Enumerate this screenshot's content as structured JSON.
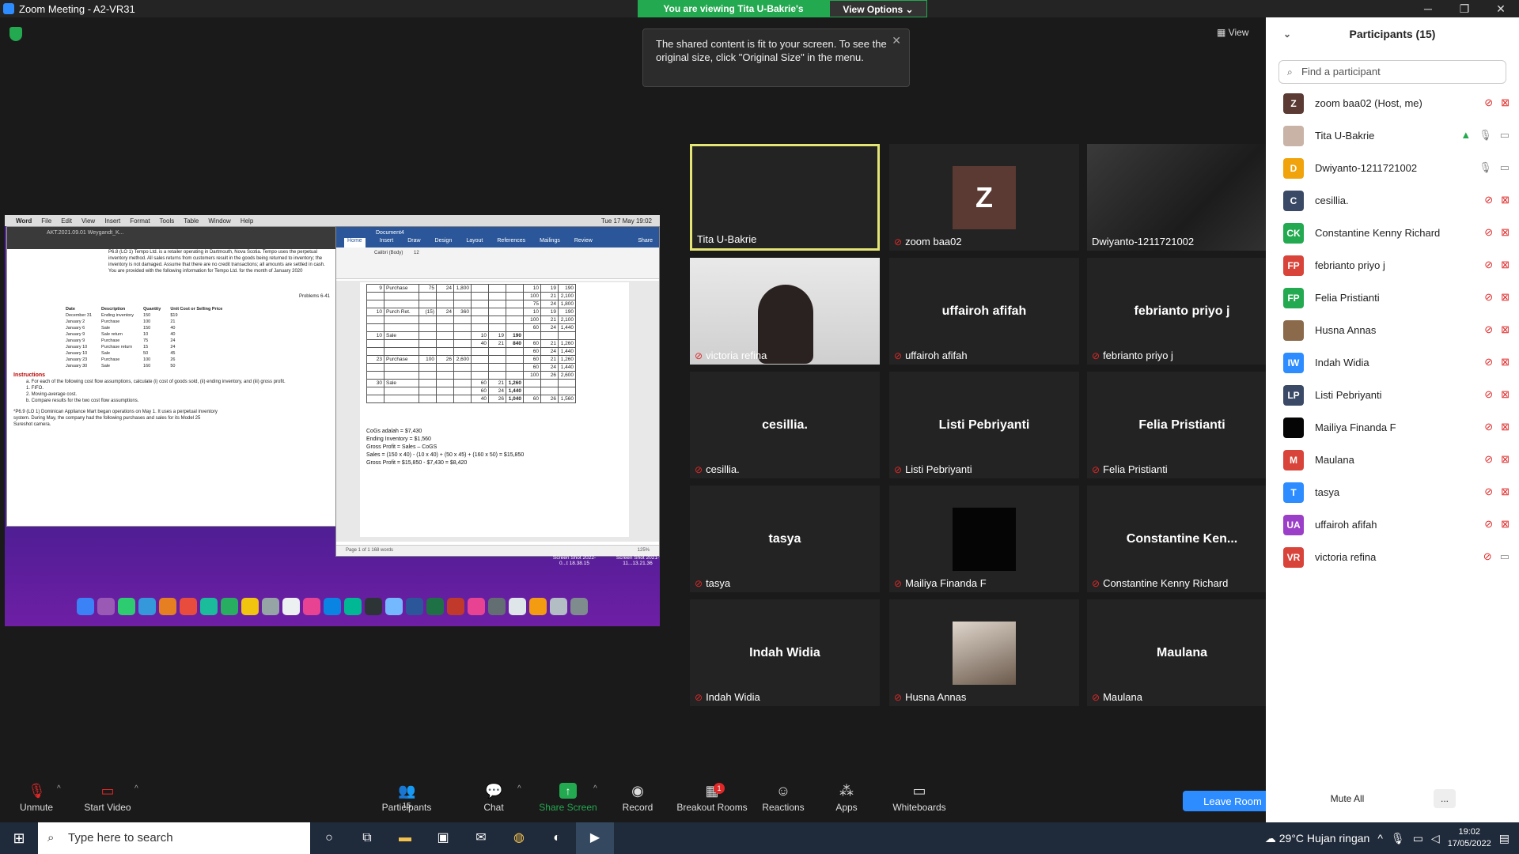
{
  "window": {
    "title": "Zoom Meeting - A2-VR31",
    "minimize": "─",
    "maximize": "❐",
    "close": "✕"
  },
  "banner": {
    "viewing": "You are viewing Tita U-Bakrie's screen",
    "view_options": "View Options ⌄"
  },
  "view_button": "View",
  "toast": {
    "text": "The shared content is fit to your screen. To see the original size, click \"Original Size\" in the menu."
  },
  "shared_screen": {
    "mac_menu": [
      "Word",
      "File",
      "Edit",
      "View",
      "Insert",
      "Format",
      "Tools",
      "Table",
      "Window",
      "Help"
    ],
    "mac_clock": "Tue 17 May 19:02",
    "pdf_title": "AKT.2021.09.01 Weygandt_K...",
    "pdf_problem": "P6.8 (LO 1) Tempo Ltd. is a retailer operating in Dartmouth, Nova Scotia. Tempo uses the perpetual inventory method. All sales returns from customers result in the goods being returned to inventory; the inventory is not damaged. Assume that there are no credit transactions; all amounts are settled in cash. You are provided with the following information for Tempo Ltd. for the month of January 2020",
    "pdf_header": "Problems 6-41",
    "pdf_table_head": [
      "Date",
      "Description",
      "Quantity",
      "Unit Cost or Selling Price"
    ],
    "pdf_table_rows": [
      [
        "December 31",
        "Ending inventory",
        "150",
        "$19"
      ],
      [
        "January 2",
        "Purchase",
        "100",
        "21"
      ],
      [
        "January 6",
        "Sale",
        "150",
        "40"
      ],
      [
        "January 9",
        "Sale return",
        "10",
        "40"
      ],
      [
        "January 9",
        "Purchase",
        "75",
        "24"
      ],
      [
        "January 10",
        "Purchase return",
        "15",
        "24"
      ],
      [
        "January 10",
        "Sale",
        "50",
        "45"
      ],
      [
        "January 23",
        "Purchase",
        "100",
        "26"
      ],
      [
        "January 30",
        "Sale",
        "160",
        "50"
      ]
    ],
    "pdf_instructions_title": "Instructions",
    "pdf_instructions": [
      "a. For each of the following cost flow assumptions, calculate (i) cost of goods sold, (ii) ending inventory, and (iii) gross profit.",
      "1. FIFO.",
      "2. Moving-average cost.",
      "b. Compare results for the two cost flow assumptions."
    ],
    "pdf_next_problem": "*P6.9 (LO 1) Dominican Appliance Mart began operations on May 1. It uses a perpetual inventory system. During May, the company had the following purchases and sales for its Model 25 Sureshot camera.",
    "word_title": "Document4",
    "word_tabs": [
      "Home",
      "Insert",
      "Draw",
      "Design",
      "Layout",
      "References",
      "Mailings",
      "Review"
    ],
    "word_font": "Calibri (Body)",
    "word_size": "12",
    "word_share": "Share",
    "word_table": [
      [
        "9",
        "Purchase",
        "75",
        "24",
        "1,800",
        "",
        "",
        "",
        "10",
        "19",
        "190"
      ],
      [
        "",
        "",
        "",
        "",
        "",
        "",
        "",
        "",
        "100",
        "21",
        "2,100"
      ],
      [
        "",
        "",
        "",
        "",
        "",
        "",
        "",
        "",
        "75",
        "24",
        "1,800"
      ],
      [
        "10",
        "Purch Ret.",
        "(15)",
        "24",
        "360",
        "",
        "",
        "",
        "10",
        "19",
        "190"
      ],
      [
        "",
        "",
        "",
        "",
        "",
        "",
        "",
        "",
        "100",
        "21",
        "2,100"
      ],
      [
        "",
        "",
        "",
        "",
        "",
        "",
        "",
        "",
        "60",
        "24",
        "1,440"
      ],
      [
        "10",
        "Sale",
        "",
        "",
        "",
        "10",
        "19",
        "190",
        "",
        "",
        ""
      ],
      [
        "",
        "",
        "",
        "",
        "",
        "40",
        "21",
        "840",
        "60",
        "21",
        "1,260"
      ],
      [
        "",
        "",
        "",
        "",
        "",
        "",
        "",
        "",
        "60",
        "24",
        "1,440"
      ],
      [
        "23",
        "Purchase",
        "100",
        "26",
        "2,600",
        "",
        "",
        "",
        "60",
        "21",
        "1,260"
      ],
      [
        "",
        "",
        "",
        "",
        "",
        "",
        "",
        "",
        "60",
        "24",
        "1,440"
      ],
      [
        "",
        "",
        "",
        "",
        "",
        "",
        "",
        "",
        "100",
        "26",
        "2,600"
      ],
      [
        "30",
        "Sale",
        "",
        "",
        "",
        "60",
        "21",
        "1,260",
        "",
        "",
        ""
      ],
      [
        "",
        "",
        "",
        "",
        "",
        "60",
        "24",
        "1,440",
        "",
        "",
        ""
      ],
      [
        "",
        "",
        "",
        "",
        "",
        "40",
        "26",
        "1,040",
        "60",
        "26",
        "1,560"
      ]
    ],
    "word_lines": [
      "CoGs adalah = $7,430",
      "Ending Inventory = $1,560",
      "Gross Profit = Sales – CoGS",
      "Sales = (150 x 40) - (10 x 40) + (50 x 45) + (160 x 50) = $15,850",
      "Gross Profit = $15,850 - $7,430 = $8,420"
    ],
    "word_status": "Page 1 of 1    168 words",
    "word_zoom": "125%",
    "screenshot1": "Screen Shot 2022-0...t 18.38.15",
    "screenshot2": "Screen Shot 2021-11...13.21.36"
  },
  "tiles": [
    {
      "name": "Tita U-Bakrie",
      "label": "",
      "muted": false
    },
    {
      "name": "zoom baa02",
      "label": "Z",
      "muted": true
    },
    {
      "name": "Dwiyanto-1211721002",
      "label": "",
      "muted": false
    },
    {
      "name": "victoria refina",
      "label": "",
      "muted": true
    },
    {
      "name": "uffairoh afifah",
      "label": "uffairoh afifah",
      "muted": true
    },
    {
      "name": "febrianto priyo j",
      "label": "febrianto priyo j",
      "muted": true
    },
    {
      "name": "cesillia.",
      "label": "cesillia.",
      "muted": true
    },
    {
      "name": "Listi Pebriyanti",
      "label": "Listi Pebriyanti",
      "muted": true
    },
    {
      "name": "Felia Pristianti",
      "label": "Felia Pristianti",
      "muted": true
    },
    {
      "name": "tasya",
      "label": "tasya",
      "muted": true
    },
    {
      "name": "Mailiya Finanda F",
      "label": "",
      "muted": true
    },
    {
      "name": "Constantine Kenny Richard",
      "label": "Constantine  Ken...",
      "muted": true
    },
    {
      "name": "Indah Widia",
      "label": "Indah Widia",
      "muted": true
    },
    {
      "name": "Husna Annas",
      "label": "",
      "muted": true
    },
    {
      "name": "Maulana",
      "label": "Maulana",
      "muted": true
    }
  ],
  "toolbar": {
    "unmute": "Unmute",
    "start_video": "Start Video",
    "participants": "Participants",
    "participants_count": "15",
    "chat": "Chat",
    "share_screen": "Share Screen",
    "record": "Record",
    "breakout_rooms": "Breakout Rooms",
    "breakout_badge": "1",
    "reactions": "Reactions",
    "apps": "Apps",
    "whiteboards": "Whiteboards",
    "leave": "Leave Room"
  },
  "panel": {
    "title": "Participants (15)",
    "search_placeholder": "Find a participant",
    "mute_all": "Mute All",
    "more": "...",
    "participants": [
      {
        "initials": "Z",
        "color": "#5a3a32",
        "name": "zoom baa02 (Host, me)"
      },
      {
        "initials": "",
        "color": "#c9b2a6",
        "name": "Tita U-Bakrie"
      },
      {
        "initials": "D",
        "color": "#f0a30a",
        "name": "Dwiyanto-1211721002"
      },
      {
        "initials": "C",
        "color": "#3a4a66",
        "name": "cesillia."
      },
      {
        "initials": "CK",
        "color": "#23a94f",
        "name": "Constantine Kenny Richard"
      },
      {
        "initials": "FP",
        "color": "#d9443a",
        "name": "febrianto priyo j"
      },
      {
        "initials": "FP",
        "color": "#23a94f",
        "name": "Felia Pristianti"
      },
      {
        "initials": "",
        "color": "#8a6a4a",
        "name": "Husna Annas"
      },
      {
        "initials": "IW",
        "color": "#2d8cff",
        "name": "Indah Widia"
      },
      {
        "initials": "LP",
        "color": "#3a4a66",
        "name": "Listi Pebriyanti"
      },
      {
        "initials": "",
        "color": "#050505",
        "name": "Mailiya Finanda F"
      },
      {
        "initials": "M",
        "color": "#d9443a",
        "name": "Maulana"
      },
      {
        "initials": "T",
        "color": "#2d8cff",
        "name": "tasya"
      },
      {
        "initials": "UA",
        "color": "#9b3fc8",
        "name": "uffairoh afifah"
      },
      {
        "initials": "VR",
        "color": "#d9443a",
        "name": "victoria refina"
      }
    ]
  },
  "taskbar": {
    "search_placeholder": "Type here to search",
    "weather": "29°C  Hujan ringan",
    "time": "19:02",
    "date": "17/05/2022"
  }
}
